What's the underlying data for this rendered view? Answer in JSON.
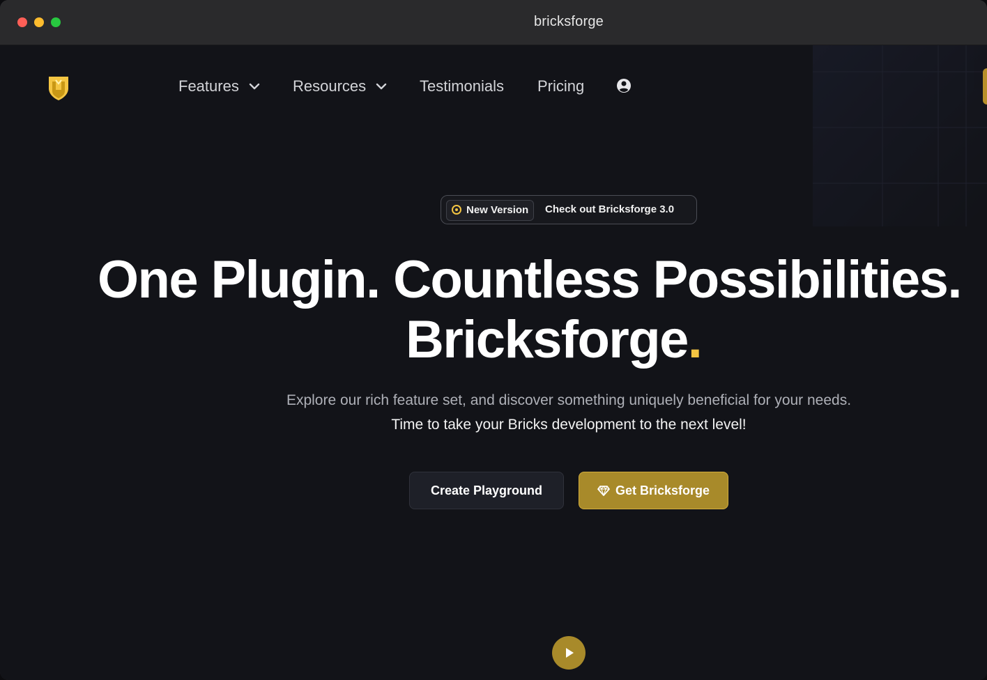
{
  "window": {
    "title": "bricksforge"
  },
  "colors": {
    "background": "#121318",
    "accent": "#a88a2a",
    "accent_light": "#f4c542",
    "text": "#ffffff",
    "muted_text": "#aeb0b7"
  },
  "nav": {
    "logo_icon": "bricksforge-logo-icon",
    "items": [
      {
        "label": "Features",
        "icon": "chevron-down-icon"
      },
      {
        "label": "Resources",
        "icon": "chevron-down-icon"
      },
      {
        "label": "Testimonials"
      },
      {
        "label": "Pricing"
      }
    ],
    "account_icon": "user-circle-icon"
  },
  "badge": {
    "pill_label": "New Version",
    "text": "Check out Bricksforge 3.0"
  },
  "hero": {
    "title_line_1": "One Plugin. Countless Possibilities.",
    "title_line_2": "Bricksforge",
    "title_dot": ".",
    "subtitle_line_1": "Explore our rich feature set, and discover something uniquely beneficial for your needs.",
    "subtitle_line_2": "Time to take your Bricks development to the next level!"
  },
  "buttons": {
    "create_playground": "Create Playground",
    "get_bricksforge": "Get Bricksforge",
    "get_bricksforge_icon": "diamond-icon",
    "play_icon": "play-icon"
  }
}
